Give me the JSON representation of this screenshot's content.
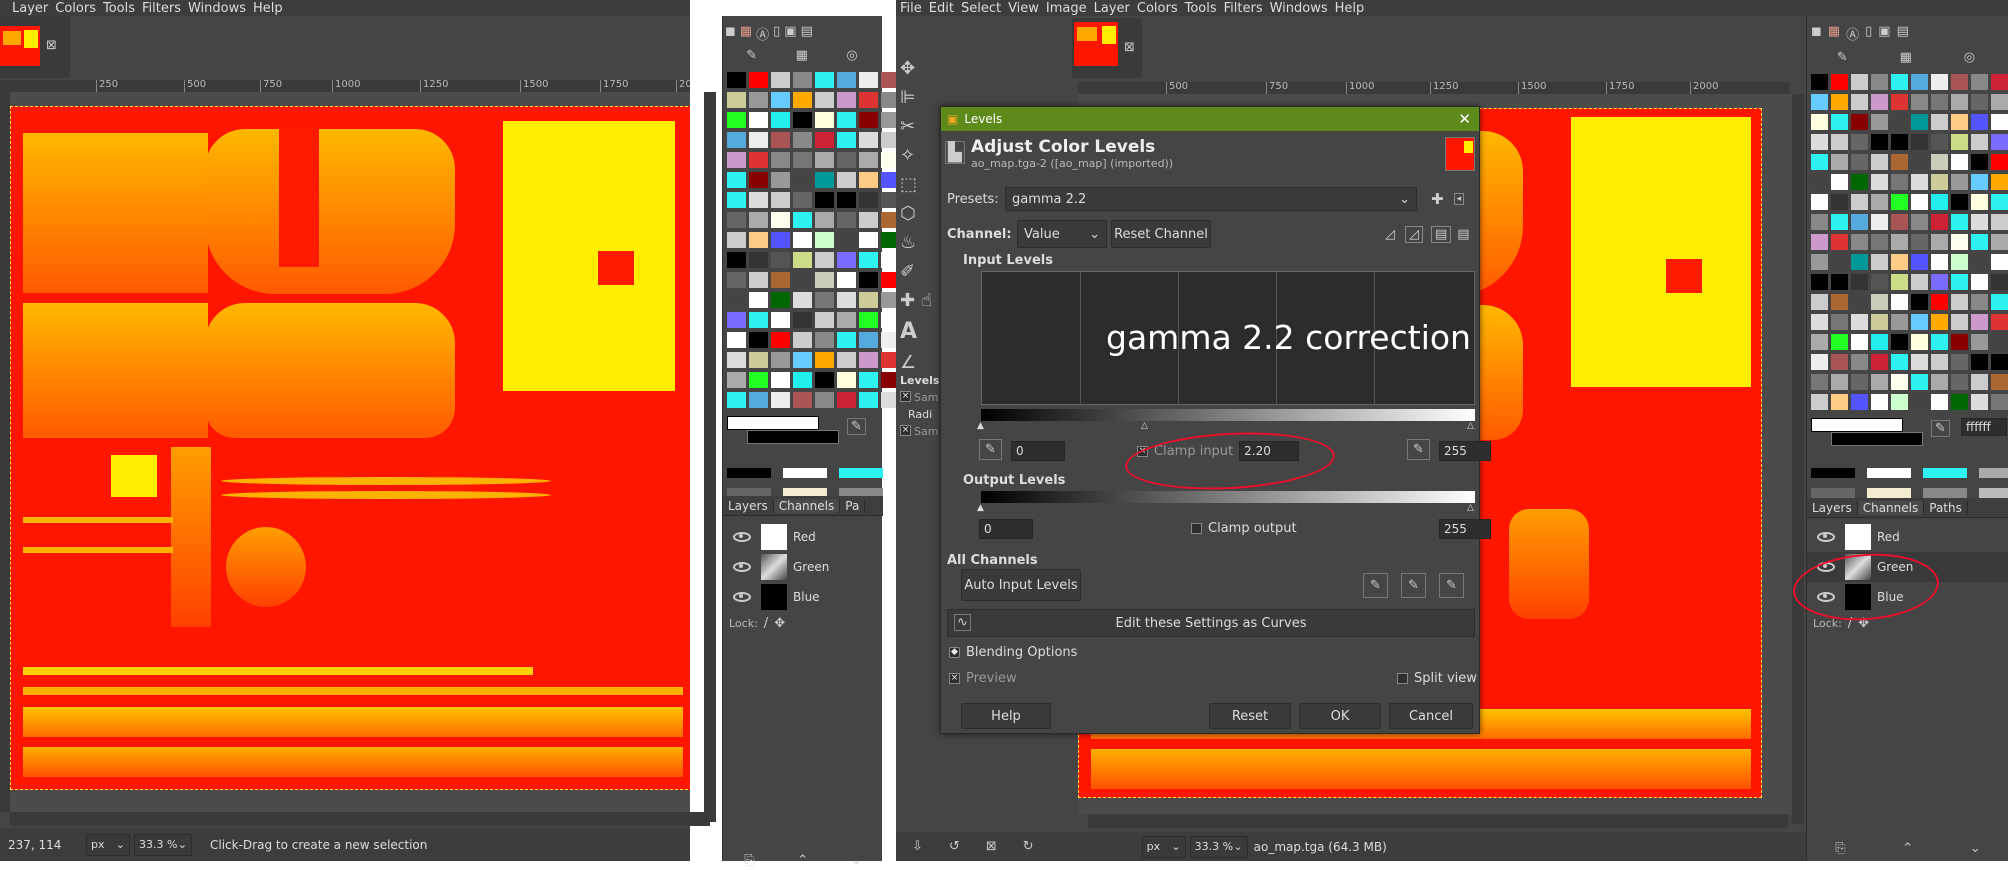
{
  "left": {
    "menu": [
      "Layer",
      "Colors",
      "Tools",
      "Filters",
      "Windows",
      "Help"
    ],
    "ruler_ticks": [
      "250",
      "500",
      "750",
      "1000",
      "1250",
      "1500",
      "1750",
      "2000"
    ],
    "tabs": [
      "Layers",
      "Channels",
      "Pa"
    ],
    "channels": [
      {
        "label": "Red"
      },
      {
        "label": "Green"
      },
      {
        "label": "Blue"
      }
    ],
    "lock_label": "Lock:",
    "status": {
      "coords": "237, 114",
      "unit": "px",
      "zoom": "33.3 %",
      "message": "Click-Drag to create a new selection"
    }
  },
  "right": {
    "menu": [
      "File",
      "Edit",
      "Select",
      "View",
      "Image",
      "Layer",
      "Colors",
      "Tools",
      "Filters",
      "Windows",
      "Help"
    ],
    "ruler_ticks": [
      "500",
      "750",
      "1000",
      "1250",
      "1500",
      "1750",
      "2000"
    ],
    "tabs": [
      "Layers",
      "Channels",
      "Paths"
    ],
    "channels": [
      {
        "label": "Red"
      },
      {
        "label": "Green"
      },
      {
        "label": "Blue"
      }
    ],
    "lock_label": "Lock:",
    "hex_value": "ffffff",
    "tool_options_label": "Levels",
    "tool_options_rows": [
      "Sam",
      "Radi",
      "Sam"
    ],
    "status": {
      "unit": "px",
      "zoom": "33.3 %",
      "file": "ao_map.tga (64.3 MB)"
    }
  },
  "dialog": {
    "window_title": "Levels",
    "heading": "Adjust Color Levels",
    "subheading": "ao_map.tga-2 ([ao_map] (imported))",
    "presets_label": "Presets:",
    "presets_value": "gamma 2.2",
    "channel_label": "Channel:",
    "channel_value": "Value",
    "reset_channel": "Reset Channel",
    "input_levels_label": "Input Levels",
    "annotation": "gamma 2.2 correction",
    "input_low": "0",
    "clamp_input_label": "Clamp input",
    "gamma": "2.20",
    "input_high": "255",
    "output_levels_label": "Output Levels",
    "output_low": "0",
    "clamp_output_label": "Clamp output",
    "output_high": "255",
    "all_channels_label": "All Channels",
    "auto_input": "Auto Input Levels",
    "edit_curves": "Edit these Settings as Curves",
    "blending": "Blending Options",
    "preview": "Preview",
    "split_view": "Split view",
    "help": "Help",
    "reset": "Reset",
    "ok": "OK",
    "cancel": "Cancel"
  },
  "colors": {
    "accent_green": "#5e8a1c",
    "annotation_red": "#e8102a",
    "map_red": "#ff1600",
    "map_yellow": "#ffee00"
  }
}
